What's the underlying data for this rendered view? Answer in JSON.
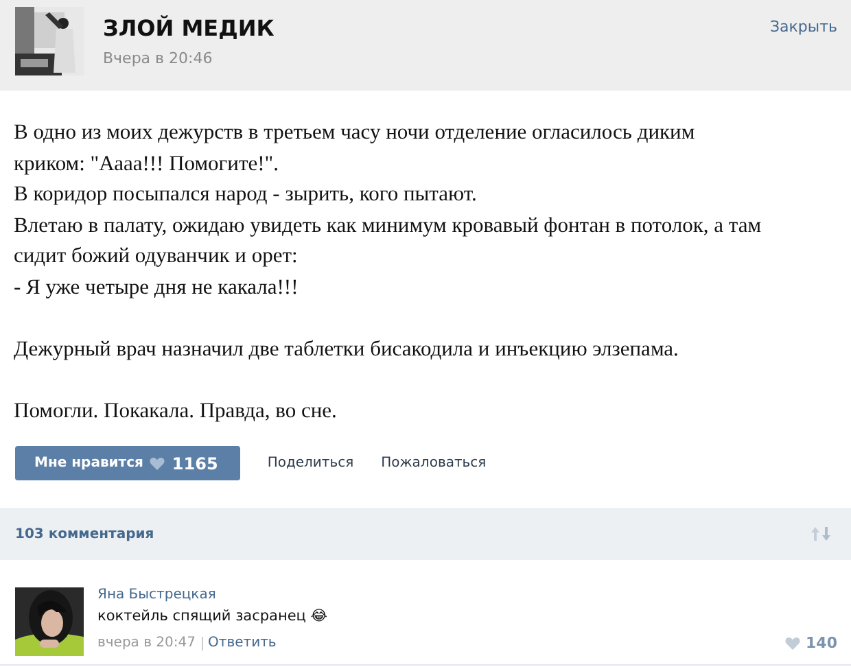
{
  "post": {
    "author": "ЗЛОЙ МЕДИК",
    "time": "Вчера в 20:46",
    "close": "Закрыть",
    "paragraphs": [
      [
        "В одно из моих дежурств в третьем часу ночи отделение огласилось диким криком: \"Аааа!!! Помогите!\".",
        "В коридор посыпался народ - зырить, кого пытают.",
        "Влетаю в палату, ожидаю увидеть как минимум кровавый фонтан в потолок, а там сидит божий одуванчик и орет:",
        "- Я уже четыре дня не какала!!!"
      ],
      [
        "Дежурный врач назначил две таблетки бисакодила и инъекцию элзепама."
      ],
      [
        "Помогли. Покакала. Правда, во сне."
      ]
    ],
    "like": {
      "label": "Мне нравится",
      "count": "1165"
    },
    "share": "Поделиться",
    "report": "Пожаловаться"
  },
  "comments_header": {
    "count": "103 комментария"
  },
  "comments": [
    {
      "author": "Яна Быстрецкая",
      "text": "коктейль спящий засранец",
      "emoji": "😂",
      "time": "вчера в 20:47",
      "reply": "Ответить",
      "likes": "140"
    }
  ]
}
